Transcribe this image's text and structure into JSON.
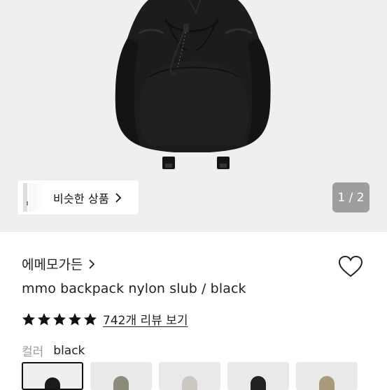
{
  "gallery": {
    "similar_label": "비슷한 상품",
    "counter": "1 / 2"
  },
  "product": {
    "brand": "에메모가든",
    "title": "mmo backpack nylon slub / black",
    "rating": 5,
    "review_link": "742개 리뷰 보기"
  },
  "color": {
    "label": "컬러",
    "value": "black",
    "swatches": [
      {
        "name": "black",
        "color": "#1a1a1a",
        "selected": true
      },
      {
        "name": "khaki",
        "color": "#8c8a78",
        "selected": false
      },
      {
        "name": "light-grey",
        "color": "#c9c7c0",
        "selected": false
      },
      {
        "name": "black-2",
        "color": "#222222",
        "selected": false
      },
      {
        "name": "beige",
        "color": "#a7997a",
        "selected": false
      }
    ]
  },
  "colors": {
    "hero_bg": "#efefef",
    "counter_bg": "#9e9e9e",
    "bag": "#1c1c1c"
  }
}
